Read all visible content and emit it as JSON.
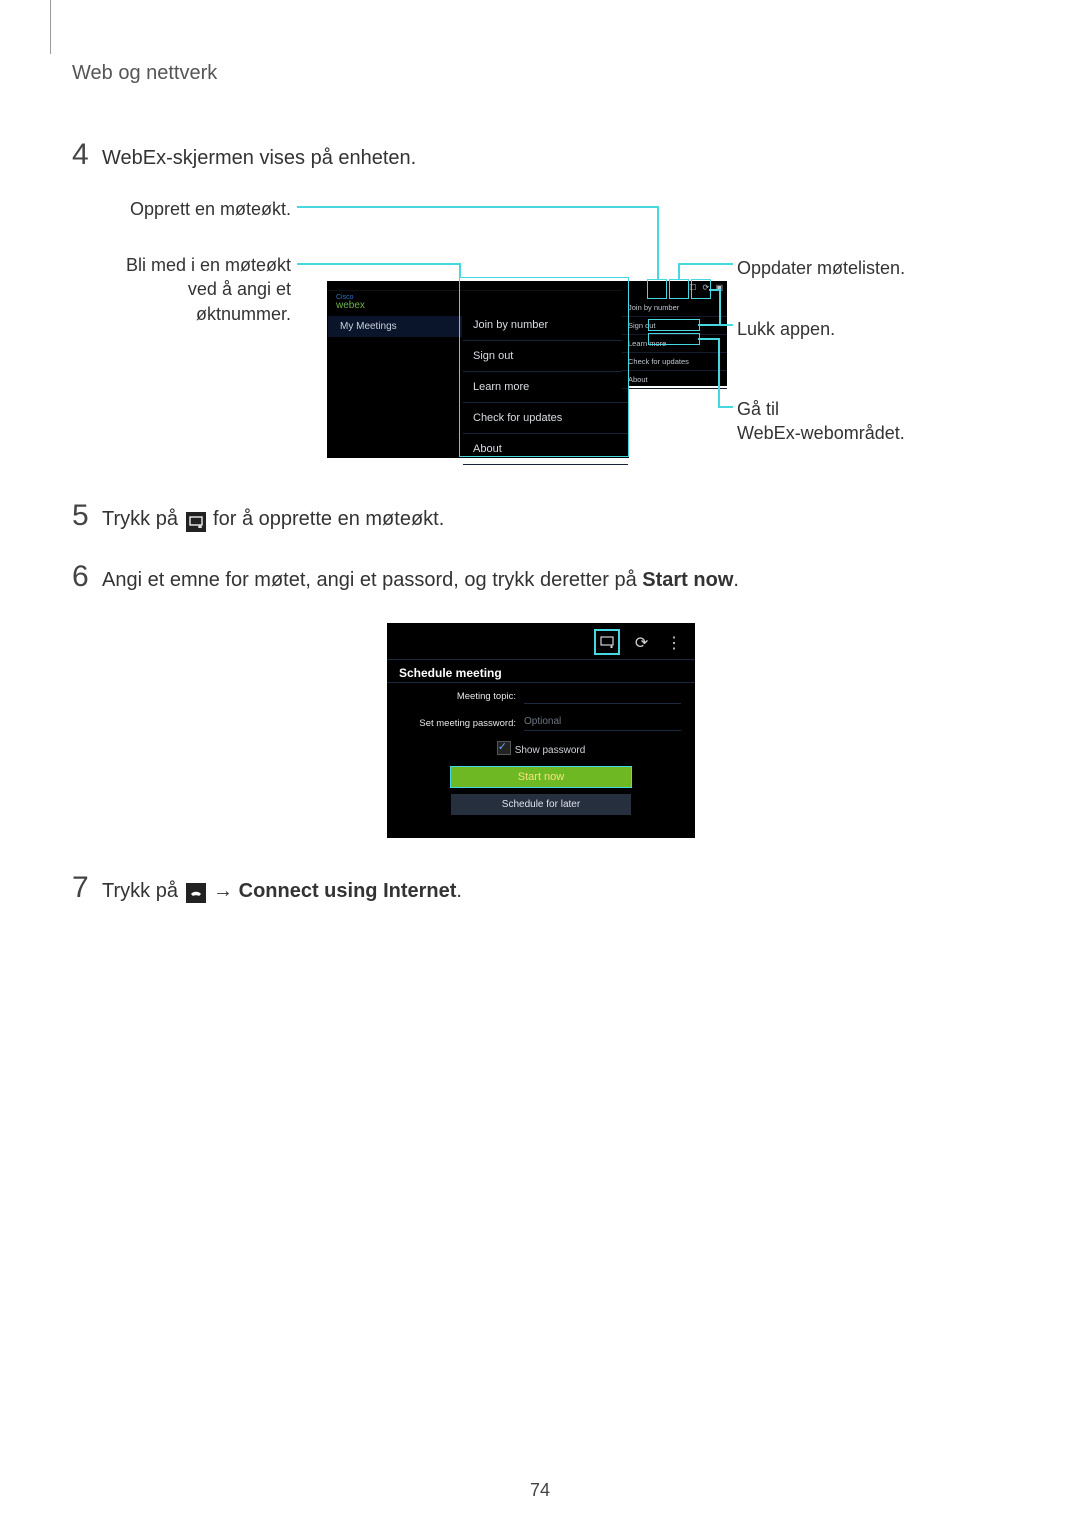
{
  "header": "Web og nettverk",
  "page_number": "74",
  "steps": {
    "s4": {
      "num": "4",
      "text": "WebEx-skjermen vises på enheten."
    },
    "s5": {
      "num": "5",
      "pre": "Trykk på ",
      "post": " for å opprette en møteøkt."
    },
    "s6": {
      "num": "6",
      "pre": "Angi et emne for møtet, angi et passord, og trykk deretter på ",
      "bold": "Start now",
      "post": "."
    },
    "s7": {
      "num": "7",
      "pre": "Trykk på ",
      "arrow": " → ",
      "bold": "Connect using Internet",
      "post": "."
    }
  },
  "callouts": {
    "create": "Opprett en møteøkt.",
    "join1": "Bli med i en møteøkt",
    "join2": "ved å angi et",
    "join3": "øktnummer.",
    "refresh": "Oppdater møtelisten.",
    "close": "Lukk appen.",
    "gotoweb1": "Gå til",
    "gotoweb2": "WebEx-webområdet."
  },
  "screenshot1": {
    "logo": "webex",
    "tab": "My Meetings",
    "menu": [
      "Join by number",
      "Sign out",
      "Learn more",
      "Check for updates",
      "About"
    ]
  },
  "screenshot1b": {
    "menu": [
      "Join by number",
      "Sign out",
      "Learn more",
      "Check for updates",
      "About"
    ]
  },
  "screenshot2": {
    "title": "Schedule meeting",
    "topic_label": "Meeting topic:",
    "password_label": "Set meeting password:",
    "password_placeholder": "Optional",
    "show_password": "Show password",
    "start_now": "Start now",
    "schedule_later": "Schedule for later"
  }
}
